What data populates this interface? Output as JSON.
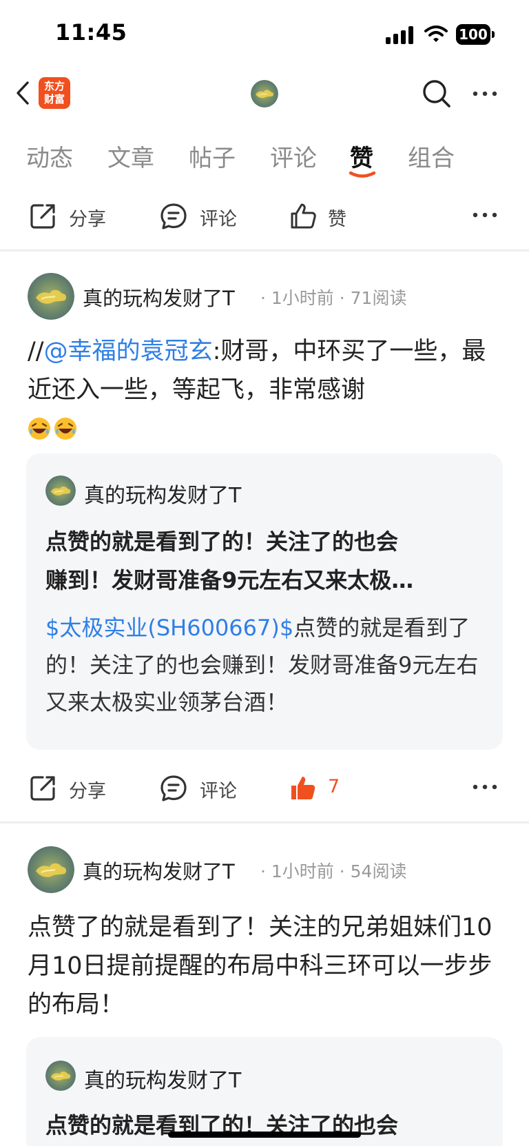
{
  "status_bar": {
    "time": "11:45",
    "battery": "100"
  },
  "nav": {
    "logo_line1": "东方",
    "logo_line2": "财富"
  },
  "tabs": [
    {
      "label": "动态",
      "active": false
    },
    {
      "label": "文章",
      "active": false
    },
    {
      "label": "帖子",
      "active": false
    },
    {
      "label": "评论",
      "active": false
    },
    {
      "label": "赞",
      "active": true
    },
    {
      "label": "组合",
      "active": false
    }
  ],
  "top_actions": {
    "share": "分享",
    "comment": "评论",
    "like": "赞"
  },
  "posts": [
    {
      "author": "真的玩构发财了T",
      "meta": "· 1小时前  · 71阅读",
      "body_prefix": "//",
      "mention": "@幸福的袁冠玄",
      "body_text": ":财哥，中环买了一些，最近还入一些，等起飞，非常感谢",
      "quote": {
        "author": "真的玩构发财了T",
        "title_line1": "点赞的就是看到了的！关注了的也会",
        "title_line2": "赚到！发财哥准备9元左右又来太极…",
        "stock": "$太极实业(SH600667)$",
        "text": "点赞的就是看到了的！关注了的也会赚到！发财哥准备9元左右又来太极实业领茅台酒！"
      },
      "actions": {
        "share": "分享",
        "comment": "评论",
        "likes": "7"
      }
    },
    {
      "author": "真的玩构发财了T",
      "meta": "· 1小时前  · 54阅读",
      "body_text": "点赞了的就是看到了！关注的兄弟姐妹们10月10日提前提醒的布局中科三环可以一步步的布局！",
      "quote": {
        "author": "真的玩构发财了T",
        "title_line1": "点赞的就是看到了的！关注了的也会"
      }
    }
  ],
  "colors": {
    "accent": "#f0501e",
    "link": "#2f7fe6",
    "card_bg": "#f5f6f8"
  },
  "icons": [
    "back-icon",
    "search-icon",
    "more-icon",
    "share-icon",
    "comment-icon",
    "thumbs-up-icon",
    "laughing-emoji"
  ]
}
